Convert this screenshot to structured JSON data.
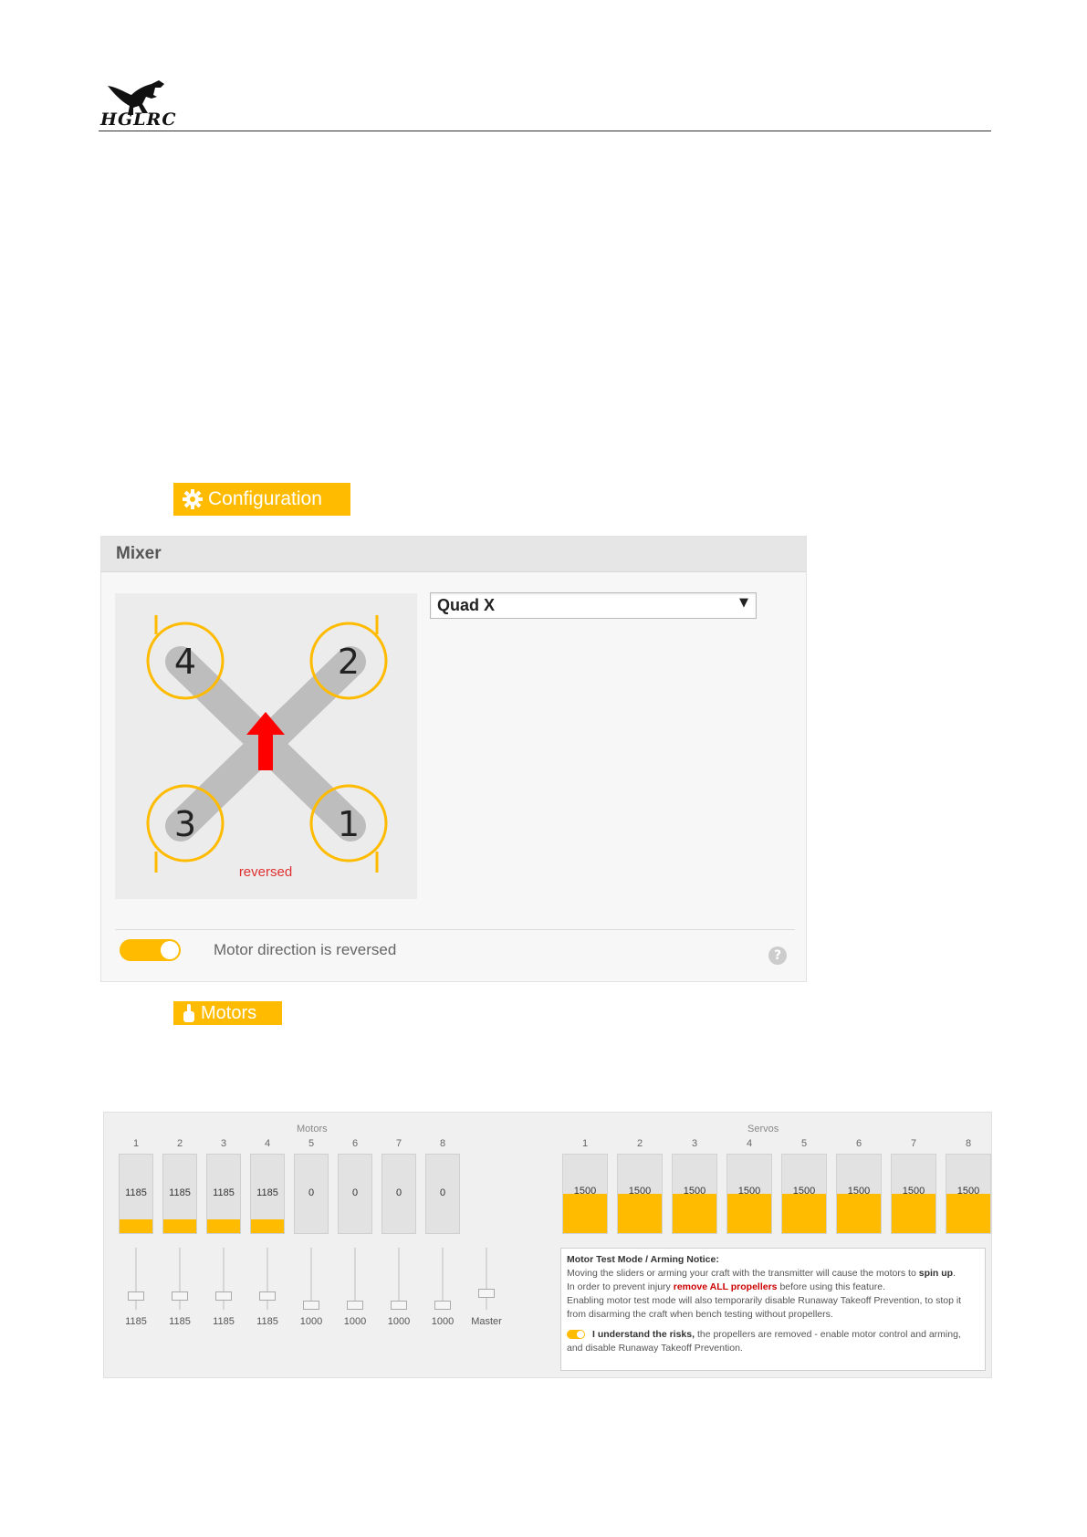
{
  "header": {
    "logo_text": "HGLRC"
  },
  "configuration_tag": {
    "label": "Configuration",
    "icon": "gear-icon"
  },
  "mixer": {
    "title": "Mixer",
    "selected": "Quad X",
    "diagram_motor_labels": [
      "4",
      "2",
      "3",
      "1"
    ],
    "diagram_note": "reversed",
    "toggle_label": "Motor direction is reversed",
    "toggle_on": true,
    "help_symbol": "?"
  },
  "motors_tag": {
    "label": "Motors",
    "icon": "hand-icon"
  },
  "motors": {
    "section_title": "Motors",
    "columns": [
      "1",
      "2",
      "3",
      "4",
      "5",
      "6",
      "7",
      "8"
    ],
    "meter_values": [
      "1185",
      "1185",
      "1185",
      "1185",
      "0",
      "0",
      "0",
      "0"
    ],
    "meter_fill": [
      0.18,
      0.18,
      0.18,
      0.18,
      0,
      0,
      0,
      0
    ],
    "slider_values": [
      "1185",
      "1185",
      "1185",
      "1185",
      "1000",
      "1000",
      "1000",
      "1000"
    ],
    "slider_levels": [
      0.185,
      0.185,
      0.185,
      0.185,
      0,
      0,
      0,
      0
    ],
    "master_label": "Master"
  },
  "servos": {
    "section_title": "Servos",
    "columns": [
      "1",
      "2",
      "3",
      "4",
      "5",
      "6",
      "7",
      "8"
    ],
    "values": [
      "1500",
      "1500",
      "1500",
      "1500",
      "1500",
      "1500",
      "1500",
      "1500"
    ],
    "fill": [
      0.5,
      0.5,
      0.5,
      0.5,
      0.5,
      0.5,
      0.5,
      0.5
    ]
  },
  "notice": {
    "title": "Motor Test Mode / Arming Notice:",
    "line1_a": "Moving the sliders or arming your craft with the transmitter will cause the motors to ",
    "line1_b": "spin up",
    "line2_a": "In order to prevent injury ",
    "line2_red": "remove ALL propellers",
    "line2_b": " before using this feature.",
    "line3": "Enabling motor test mode will also temporarily disable Runaway Takeoff Prevention, to stop it from disarming the craft when bench testing without propellers.",
    "risk_bold": "I understand the risks,",
    "risk_text": " the propellers are removed - enable motor control and arming, and disable Runaway Takeoff Prevention."
  },
  "colors": {
    "accent": "#ffbb00",
    "arrow": "#ff0000",
    "warning": "#cc0000"
  }
}
